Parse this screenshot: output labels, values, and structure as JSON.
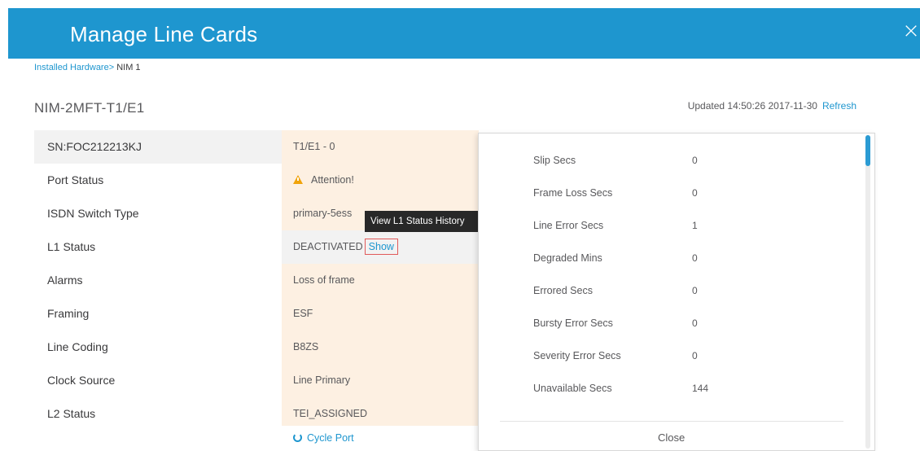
{
  "header": {
    "title": "Manage Line Cards",
    "close_glyph": "×"
  },
  "breadcrumb": {
    "link": "Installed Hardware>",
    "current": " NIM 1"
  },
  "card": {
    "title": "NIM-2MFT-T1/E1"
  },
  "updated": {
    "text": "Updated 14:50:26 2017-11-30",
    "refresh_label": "Refresh"
  },
  "labels": [
    "SN:FOC212213KJ",
    "Port Status",
    "ISDN Switch Type",
    "L1 Status",
    "Alarms",
    "Framing",
    "Line Coding",
    "Clock Source",
    "L2 Status"
  ],
  "values": {
    "port": "T1/E1 - 0",
    "attention": "Attention!",
    "switch_type": "primary-5ess",
    "l1_status": "DEACTIVATED",
    "show_label": "Show",
    "alarms": "Loss of frame",
    "framing": "ESF",
    "line_coding": "B8ZS",
    "clock_source": "Line Primary",
    "l2_status": "TEI_ASSIGNED"
  },
  "cycle_port_label": "Cycle Port",
  "tooltip": "View L1 Status History",
  "popup": {
    "stats": [
      {
        "label": "Slip Secs",
        "value": "0"
      },
      {
        "label": "Frame Loss Secs",
        "value": "0"
      },
      {
        "label": "Line Error Secs",
        "value": "1"
      },
      {
        "label": "Degraded Mins",
        "value": "0"
      },
      {
        "label": "Errored Secs",
        "value": "0"
      },
      {
        "label": "Bursty Error Secs",
        "value": "0"
      },
      {
        "label": "Severity Error Secs",
        "value": "0"
      },
      {
        "label": "Unavailable Secs",
        "value": "144"
      }
    ],
    "close_label": "Close"
  },
  "colors": {
    "header": "#1e96cf",
    "accent": "#1e96cf",
    "warning": "#f0a30a",
    "value_bg": "#fdf0e2",
    "highlight_border": "#e05a5a"
  },
  "icons": {
    "close": "close-icon",
    "warning": "warning-icon",
    "cycle": "cycle-icon"
  }
}
